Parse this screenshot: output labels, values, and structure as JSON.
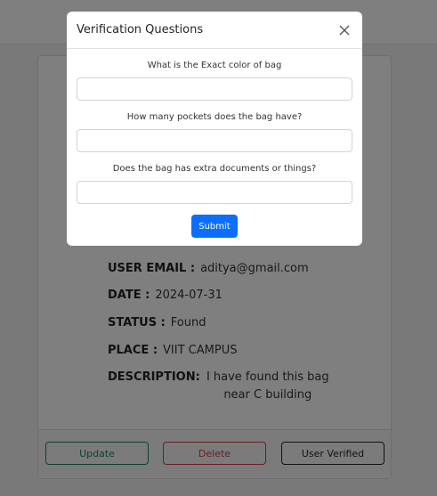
{
  "card": {
    "details": [
      {
        "label": "USER EMAIL :",
        "value": "aditya@gmail.com"
      },
      {
        "label": "DATE :",
        "value": "2024-07-31"
      },
      {
        "label": "STATUS :",
        "value": "Found"
      },
      {
        "label": "PLACE :",
        "value": "VIIT CAMPUS"
      }
    ],
    "description": {
      "label": "DESCRIPTION:",
      "line1": "I have found this bag",
      "line2": "near C building"
    },
    "buttons": {
      "update": "Update",
      "delete": "Delete",
      "verified": "User Verified"
    }
  },
  "modal": {
    "title": "Verification Questions",
    "questions": [
      {
        "label": "What is the Exact color of bag",
        "value": ""
      },
      {
        "label": "How many pockets does the bag have?",
        "value": ""
      },
      {
        "label": "Does the bag has extra documents or things?",
        "value": ""
      }
    ],
    "submit_label": "Submit"
  }
}
